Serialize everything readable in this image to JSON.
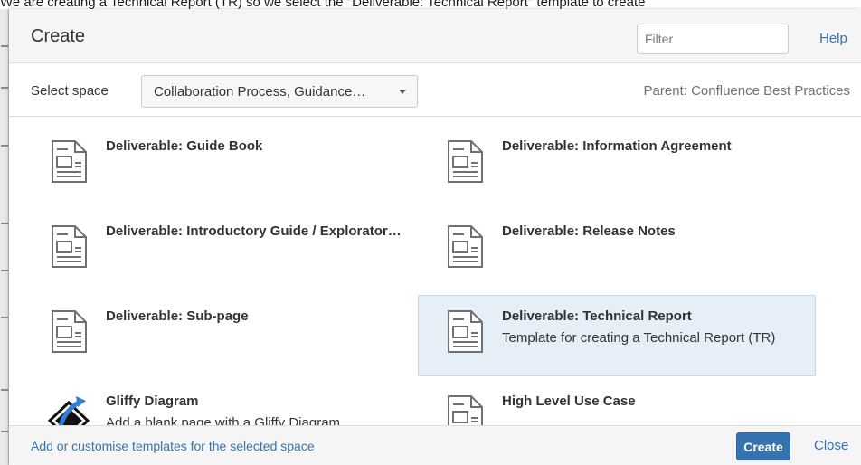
{
  "background": {
    "caption": "We are creating a Technical Report (TR) so we select the \"Deliverable: Technical Report\" template to create"
  },
  "dialog": {
    "title": "Create",
    "filter": {
      "placeholder": "Filter",
      "value": ""
    },
    "help_label": "Help",
    "space": {
      "label": "Select space",
      "selected": "Collaboration Process, Guidance…",
      "parent": "Parent: Confluence Best Practices"
    },
    "templates": [
      {
        "name": "Deliverable: Guide Book",
        "description": "",
        "icon": "document-icon",
        "selected": false
      },
      {
        "name": "Deliverable: Information Agreement",
        "description": "",
        "icon": "document-icon",
        "selected": false
      },
      {
        "name": "Deliverable: Introductory Guide / Explorator…",
        "description": "",
        "icon": "document-icon",
        "selected": false
      },
      {
        "name": "Deliverable: Release Notes",
        "description": "",
        "icon": "document-icon",
        "selected": false
      },
      {
        "name": "Deliverable: Sub-page",
        "description": "",
        "icon": "document-icon",
        "selected": false
      },
      {
        "name": "Deliverable: Technical Report",
        "description": "Template for creating a Technical Report (TR)",
        "icon": "document-icon",
        "selected": true
      },
      {
        "name": "Gliffy Diagram",
        "description": "Add a blank page with a Gliffy Diagram.",
        "icon": "gliffy-icon",
        "selected": false
      },
      {
        "name": "High Level Use Case",
        "description": "",
        "icon": "document-icon",
        "selected": false
      }
    ],
    "footer": {
      "customise_link": "Add or customise templates for the selected space",
      "create_label": "Create",
      "close_label": "Close"
    }
  },
  "colors": {
    "accent": "#3572b0",
    "selected_bg": "#e6eef7",
    "header_bg": "#f5f5f5"
  }
}
